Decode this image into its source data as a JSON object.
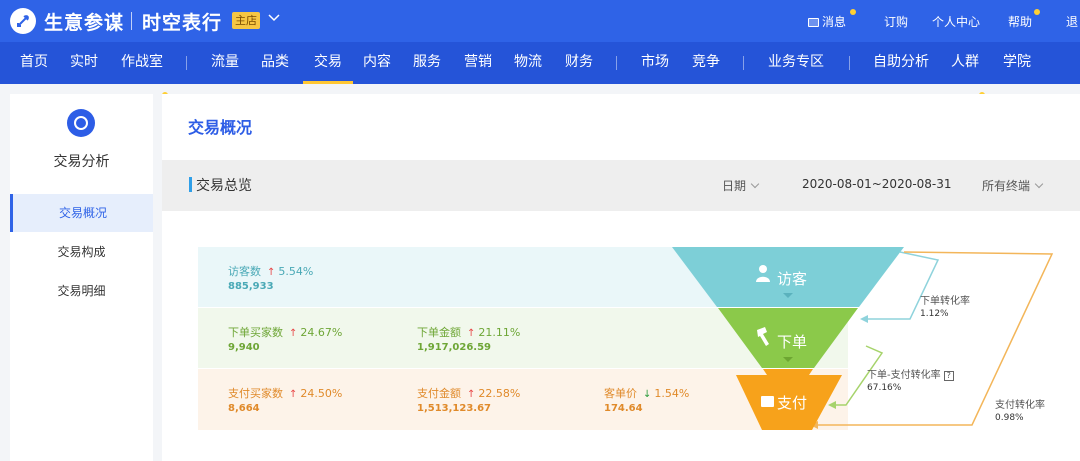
{
  "header": {
    "brand": "生意参谋",
    "shop_name": "时空表行",
    "shop_badge": "主店",
    "links": [
      "消息",
      "订购",
      "个人中心",
      "帮助",
      "退"
    ]
  },
  "nav": {
    "items": [
      "首页",
      "实时",
      "作战室",
      "流量",
      "品类",
      "交易",
      "内容",
      "服务",
      "营销",
      "物流",
      "财务",
      "市场",
      "竞争",
      "业务专区",
      "自助分析",
      "人群",
      "学院"
    ],
    "active": "交易"
  },
  "sidebar": {
    "title": "交易分析",
    "items": [
      "交易概况",
      "交易构成",
      "交易明细"
    ],
    "active": "交易概况"
  },
  "main": {
    "title": "交易概况",
    "section_title": "交易总览",
    "filters": {
      "date_label": "日期",
      "date_range": "2020-08-01~2020-08-31",
      "terminal": "所有终端"
    }
  },
  "funnel": {
    "visit": {
      "stage": "访客",
      "metrics": [
        {
          "label": "访客数",
          "trend": "↑",
          "change": "5.54%",
          "value": "885,933"
        }
      ]
    },
    "order": {
      "stage": "下单",
      "metrics": [
        {
          "label": "下单买家数",
          "trend": "↑",
          "change": "24.67%",
          "value": "9,940"
        },
        {
          "label": "下单金额",
          "trend": "↑",
          "change": "21.11%",
          "value": "1,917,026.59"
        }
      ]
    },
    "pay": {
      "stage": "支付",
      "metrics": [
        {
          "label": "支付买家数",
          "trend": "↑",
          "change": "24.50%",
          "value": "8,664"
        },
        {
          "label": "支付金额",
          "trend": "↑",
          "change": "22.58%",
          "value": "1,513,123.67"
        },
        {
          "label": "客单价",
          "trend": "↓",
          "change": "1.54%",
          "value": "174.64"
        }
      ]
    },
    "conversions": [
      {
        "label": "下单转化率",
        "value": "1.12%"
      },
      {
        "label": "下单-支付转化率",
        "value": "67.16%"
      },
      {
        "label": "支付转化率",
        "value": "0.98%"
      }
    ],
    "colors": {
      "visit": "#7dcfd7",
      "order": "#8bc94a",
      "pay": "#f7a21b",
      "line_visit": "#8fd3dc",
      "line_order": "#a6d36b",
      "line_pay": "#f3b65a"
    }
  }
}
